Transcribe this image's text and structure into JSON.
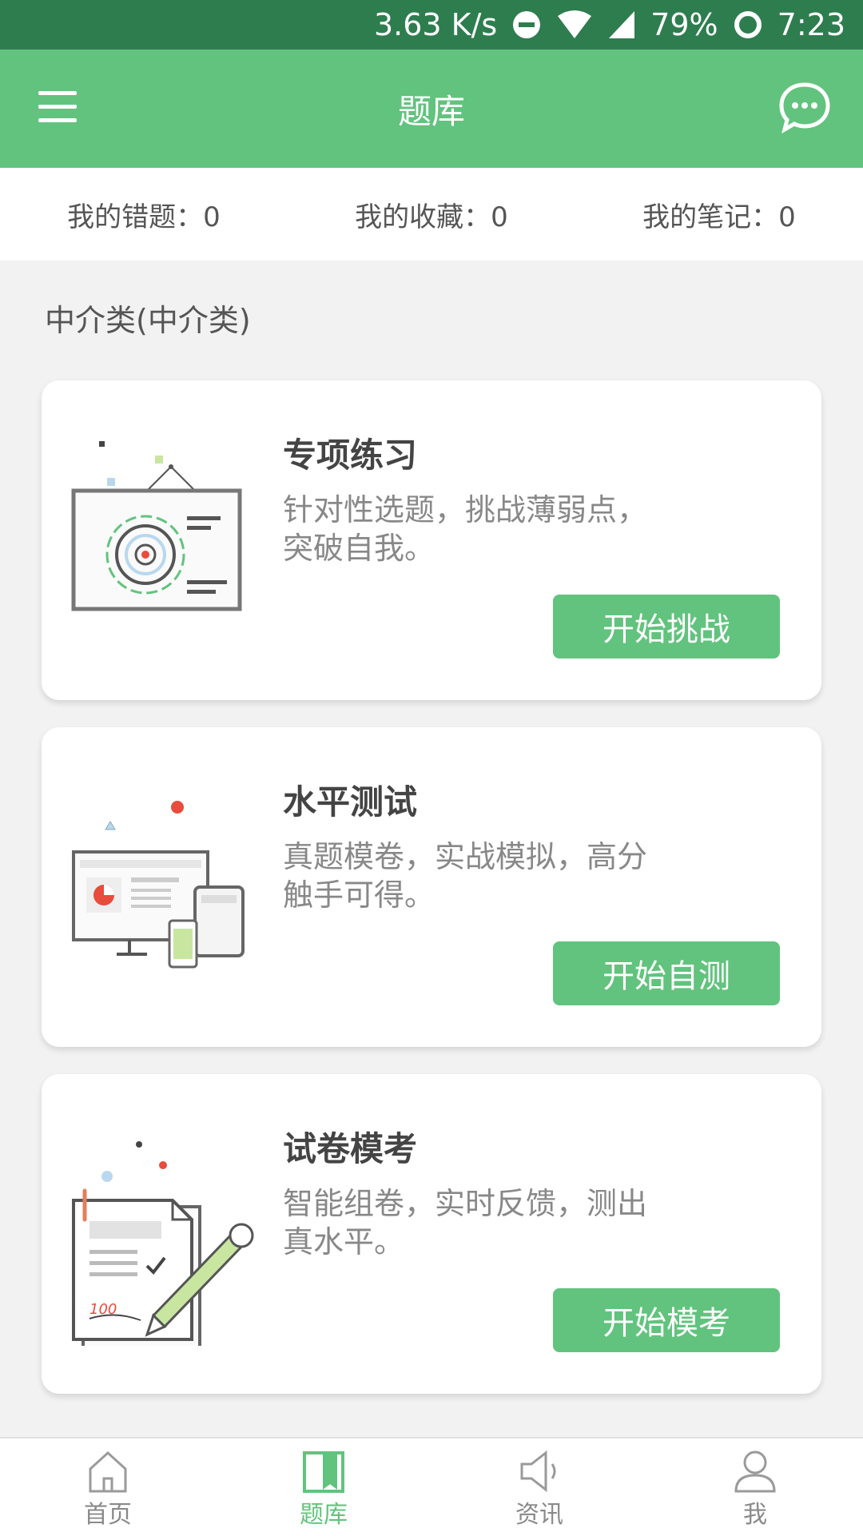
{
  "status_bar": {
    "speed": "3.63 K/s",
    "battery": "79%",
    "time": "7:23"
  },
  "header": {
    "title": "题库"
  },
  "stats": [
    {
      "label": "我的错题：0"
    },
    {
      "label": "我的收藏：0"
    },
    {
      "label": "我的笔记：0"
    }
  ],
  "section": {
    "title": "中介类(中介类)"
  },
  "cards": [
    {
      "title": "专项练习",
      "desc_line1": "针对性选题，挑战薄弱点，",
      "desc_line2": "突破自我。",
      "button": "开始挑战"
    },
    {
      "title": "水平测试",
      "desc_line1": "真题模卷，实战模拟，高分",
      "desc_line2": "触手可得。",
      "button": "开始自测"
    },
    {
      "title": "试卷模考",
      "desc_line1": "智能组卷，实时反馈，测出",
      "desc_line2": "真水平。",
      "button": "开始模考"
    }
  ],
  "tabs": [
    {
      "label": "首页",
      "icon": "home-icon"
    },
    {
      "label": "题库",
      "icon": "question-bank-icon",
      "active": true
    },
    {
      "label": "资讯",
      "icon": "news-speaker-icon"
    },
    {
      "label": "我",
      "icon": "profile-icon"
    }
  ],
  "colors": {
    "primary": "#62c37e",
    "status_bar": "#2e7d4f",
    "background": "#f2f2f2"
  }
}
